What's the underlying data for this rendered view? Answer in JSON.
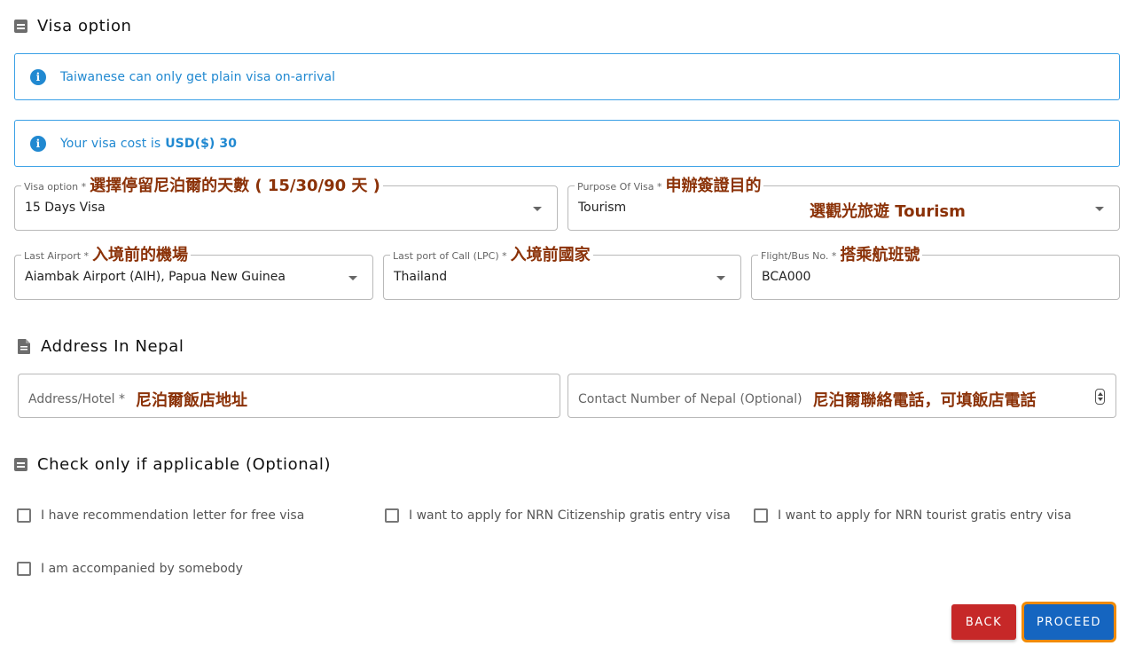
{
  "visa_section": {
    "title": "Visa option",
    "alerts": [
      {
        "text": "Taiwanese can only get plain visa on-arrival",
        "emphasis": ""
      },
      {
        "text": "Your visa cost is",
        "emphasis": "USD($) 30"
      }
    ],
    "fields": {
      "visa_option": {
        "label": "Visa option *",
        "value": "15 Days Visa",
        "annotation": "選擇停留尼泊爾的天數 ( 15/30/90 天 )"
      },
      "purpose": {
        "label": "Purpose Of Visa *",
        "value": "Tourism",
        "annotation": "申辦簽證目的",
        "value_annotation": "選觀光旅遊 Tourism"
      },
      "last_airport": {
        "label": "Last Airport *",
        "value": "Aiambak Airport (AIH), Papua New Guinea",
        "annotation": "入境前的機場"
      },
      "last_port": {
        "label": "Last port of Call (LPC) *",
        "value": "Thailand",
        "annotation": "入境前國家"
      },
      "flight_no": {
        "label": "Flight/Bus No. *",
        "value": "BCA000",
        "annotation": "搭乘航班號"
      }
    }
  },
  "address_section": {
    "title": "Address In Nepal",
    "address": {
      "placeholder": "Address/Hotel *",
      "annotation": "尼泊爾飯店地址"
    },
    "contact": {
      "placeholder": "Contact Number of Nepal (Optional)",
      "annotation": "尼泊爾聯絡電話，可填飯店電話"
    }
  },
  "optional_section": {
    "title": "Check only if applicable (Optional)",
    "checkboxes": [
      {
        "label": "I have recommendation letter for free visa",
        "checked": false
      },
      {
        "label": "I want to apply for NRN Citizenship gratis entry visa",
        "checked": false
      },
      {
        "label": "I want to apply for NRN tourist gratis entry visa",
        "checked": false
      },
      {
        "label": "I am accompanied by somebody",
        "checked": false
      }
    ]
  },
  "actions": {
    "back": "BACK",
    "proceed": "PROCEED"
  },
  "icons": {
    "section": "minus-square-icon",
    "document": "document-icon",
    "info": "info-icon",
    "dropdown": "caret-down-icon",
    "spinner": "number-spinner-icon"
  },
  "colors": {
    "info": "#2189d1",
    "annotation": "#8b3208",
    "back": "#c62828",
    "proceed": "#1565c0",
    "highlight": "#f08a00"
  }
}
